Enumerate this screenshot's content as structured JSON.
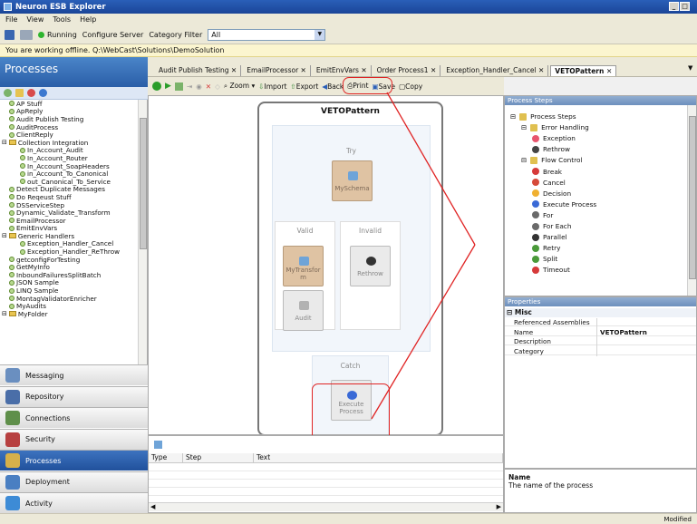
{
  "app": {
    "title": "Neuron ESB Explorer"
  },
  "menu": [
    "File",
    "View",
    "Tools",
    "Help"
  ],
  "toolbar": {
    "running": "Running",
    "configure": "Configure Server",
    "category_label": "Category Filter",
    "category_value": "All"
  },
  "offline_message": "You are working offline. Q:\\WebCast\\Solutions\\DemoSolution",
  "left": {
    "title": "Processes",
    "tree": [
      {
        "label": "AP Stuff",
        "level": 1,
        "kind": "item"
      },
      {
        "label": "ApReply",
        "level": 1,
        "kind": "item"
      },
      {
        "label": "Audit Publish Testing",
        "level": 1,
        "kind": "item"
      },
      {
        "label": "AuditProcess",
        "level": 1,
        "kind": "item"
      },
      {
        "label": "ClientReply",
        "level": 1,
        "kind": "item"
      },
      {
        "label": "Collection Integration",
        "level": 0,
        "kind": "folder"
      },
      {
        "label": "In_Account_Audit",
        "level": 2,
        "kind": "item"
      },
      {
        "label": "In_Account_Router",
        "level": 2,
        "kind": "item"
      },
      {
        "label": "In_Account_SoapHeaders",
        "level": 2,
        "kind": "item"
      },
      {
        "label": "in_Account_To_Canonical",
        "level": 2,
        "kind": "item"
      },
      {
        "label": "out_Canonical_To_Service",
        "level": 2,
        "kind": "item"
      },
      {
        "label": "Detect Duplicate Messages",
        "level": 1,
        "kind": "item"
      },
      {
        "label": "Do Reqeust Stuff",
        "level": 1,
        "kind": "item"
      },
      {
        "label": "DSServiceStep",
        "level": 1,
        "kind": "item"
      },
      {
        "label": "Dynamic_Validate_Transform",
        "level": 1,
        "kind": "item"
      },
      {
        "label": "EmailProcessor",
        "level": 1,
        "kind": "item"
      },
      {
        "label": "EmitEnvVars",
        "level": 1,
        "kind": "item"
      },
      {
        "label": "Generic Handlers",
        "level": 0,
        "kind": "folder"
      },
      {
        "label": "Exception_Handler_Cancel",
        "level": 2,
        "kind": "item"
      },
      {
        "label": "Exception_Handler_ReThrow",
        "level": 2,
        "kind": "item"
      },
      {
        "label": "getconfigForTesting",
        "level": 1,
        "kind": "item"
      },
      {
        "label": "GetMyInfo",
        "level": 1,
        "kind": "item"
      },
      {
        "label": "InboundFailuresSplitBatch",
        "level": 1,
        "kind": "item"
      },
      {
        "label": "JSON Sample",
        "level": 1,
        "kind": "item"
      },
      {
        "label": "LINQ Sample",
        "level": 1,
        "kind": "item"
      },
      {
        "label": "MontagValidatorEnricher",
        "level": 1,
        "kind": "item"
      },
      {
        "label": "MyAudits",
        "level": 1,
        "kind": "item"
      },
      {
        "label": "MyFolder",
        "level": 0,
        "kind": "folder"
      }
    ],
    "nav": [
      {
        "label": "Messaging",
        "color": "#6a8fc0"
      },
      {
        "label": "Repository",
        "color": "#4a6ea8"
      },
      {
        "label": "Connections",
        "color": "#5f8f4a"
      },
      {
        "label": "Security",
        "color": "#b74040"
      },
      {
        "label": "Processes",
        "color": "#d6b04a"
      },
      {
        "label": "Deployment",
        "color": "#4a7fc2"
      },
      {
        "label": "Activity",
        "color": "#3d8bd6"
      }
    ]
  },
  "tabs": [
    {
      "label": "Audit Publish Testing  ✕"
    },
    {
      "label": "EmailProcessor  ✕"
    },
    {
      "label": "EmitEnvVars  ✕"
    },
    {
      "label": "Order Process1  ✕"
    },
    {
      "label": "Exception_Handler_Cancel  ✕"
    },
    {
      "label": "VETOPattern  ✕"
    }
  ],
  "editor_toolbar": {
    "zoom": "Zoom",
    "import": "Import",
    "export": "Export",
    "back": "Back",
    "print": "Print",
    "save": "Save",
    "copy": "Copy"
  },
  "canvas": {
    "title": "VETOPattern",
    "try": "Try",
    "valid": "Valid",
    "invalid": "Invalid",
    "catch": "Catch",
    "steps": {
      "schema": "MySchema",
      "transform": "MyTransfor\nm",
      "rethrow": "Rethrow",
      "audit": "Audit",
      "execute": "Execute\nProcess"
    }
  },
  "bottom_grid": {
    "columns": [
      "Type",
      "Step",
      "Text"
    ]
  },
  "process_steps": {
    "header": "Process Steps",
    "items": [
      {
        "label": "Process Steps",
        "level": 0,
        "color": "#e0c050"
      },
      {
        "label": "Error Handling",
        "level": 1,
        "color": "#e0c050"
      },
      {
        "label": "Exception",
        "level": 2,
        "color": "#e8556e"
      },
      {
        "label": "Rethrow",
        "level": 2,
        "color": "#444444"
      },
      {
        "label": "Flow Control",
        "level": 1,
        "color": "#e0c050"
      },
      {
        "label": "Break",
        "level": 2,
        "color": "#d63a3a"
      },
      {
        "label": "Cancel",
        "level": 2,
        "color": "#d64a3a"
      },
      {
        "label": "Decision",
        "level": 2,
        "color": "#f0b030"
      },
      {
        "label": "Execute Process",
        "level": 2,
        "color": "#3a6ad6"
      },
      {
        "label": "For",
        "level": 2,
        "color": "#6a6a6a"
      },
      {
        "label": "For Each",
        "level": 2,
        "color": "#6a6a6a"
      },
      {
        "label": "Parallel",
        "level": 2,
        "color": "#333333"
      },
      {
        "label": "Retry",
        "level": 2,
        "color": "#4a9a3a"
      },
      {
        "label": "Split",
        "level": 2,
        "color": "#4a9a3a"
      },
      {
        "label": "Timeout",
        "level": 2,
        "color": "#d63a3a"
      }
    ]
  },
  "properties": {
    "header": "Properties",
    "section": "Misc",
    "rows": [
      {
        "key": "Referenced Assemblies",
        "value": ""
      },
      {
        "key": "Name",
        "value": "VETOPattern"
      },
      {
        "key": "Description",
        "value": ""
      },
      {
        "key": "Category",
        "value": ""
      }
    ],
    "desc_title": "Name",
    "desc_text": "The name of the process"
  },
  "status": "Modified"
}
